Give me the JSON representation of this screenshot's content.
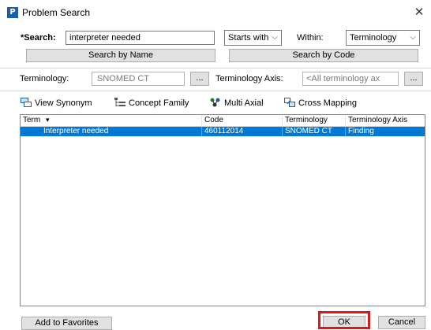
{
  "window": {
    "app_icon_letter": "P",
    "title": "Problem Search",
    "close_glyph": "✕"
  },
  "search": {
    "label": "*Search:",
    "value": "interpreter needed",
    "mode_selected": "Starts with",
    "within_label": "Within:",
    "within_selected": "Terminology",
    "by_name_label": "Search by Name",
    "by_code_label": "Search by Code"
  },
  "terminology": {
    "label": "Terminology:",
    "value": "SNOMED CT",
    "browse_label": "...",
    "axis_label": "Terminology Axis:",
    "axis_value": "<All terminology ax",
    "axis_browse_label": "..."
  },
  "toolbar": {
    "view_synonym": "View Synonym",
    "concept_family": "Concept Family",
    "multi_axial": "Multi Axial",
    "cross_mapping": "Cross Mapping"
  },
  "results": {
    "columns": [
      "Term",
      "Code",
      "Terminology",
      "Terminology Axis"
    ],
    "sort_indicator": "▾",
    "rows": [
      {
        "term": "Interpreter needed",
        "code": "460112014",
        "terminology": "SNOMED CT",
        "axis": "Finding",
        "selected": true
      }
    ]
  },
  "footer": {
    "add_favorites": "Add to Favorites",
    "ok": "OK",
    "cancel": "Cancel"
  },
  "colors": {
    "selection": "#0078d7",
    "ok_highlight": "#e0161b",
    "app_icon": "#1c5fa8"
  }
}
